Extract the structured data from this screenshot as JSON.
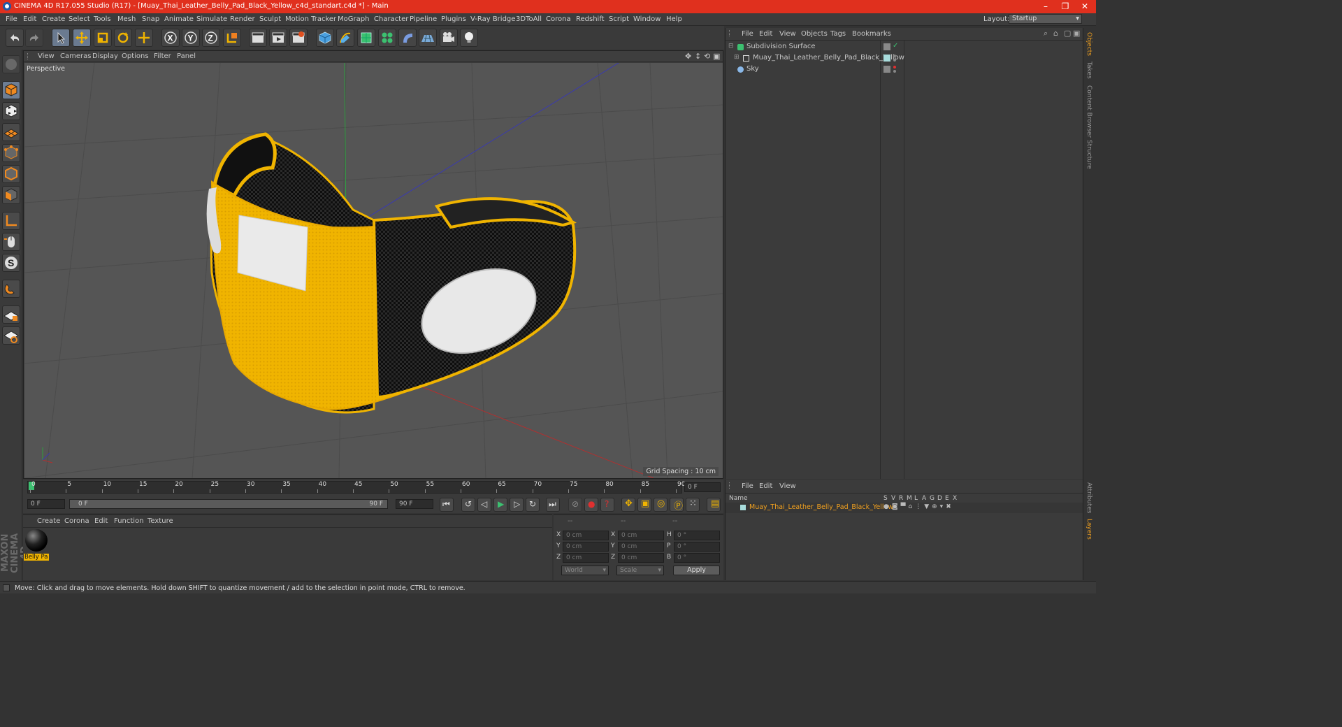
{
  "window": {
    "title": "CINEMA 4D R17.055 Studio (R17) - [Muay_Thai_Leather_Belly_Pad_Black_Yellow_c4d_standart.c4d *] - Main"
  },
  "menu": [
    "File",
    "Edit",
    "Create",
    "Select",
    "Tools",
    "Mesh",
    "Snap",
    "Animate",
    "Simulate",
    "Render",
    "Sculpt",
    "Motion Tracker",
    "MoGraph",
    "Character",
    "Pipeline",
    "Plugins",
    "V-Ray Bridge",
    "3DToAll",
    "Corona",
    "Redshift",
    "Script",
    "Window",
    "Help"
  ],
  "layout": {
    "label": "Layout:",
    "value": "Startup"
  },
  "viewport": {
    "menu": [
      "View",
      "Cameras",
      "Display",
      "Options",
      "Filter",
      "Panel"
    ],
    "label": "Perspective",
    "grid_spacing": "Grid Spacing : 10 cm"
  },
  "timeline": {
    "ticks": [
      "0",
      "5",
      "10",
      "15",
      "20",
      "25",
      "30",
      "35",
      "40",
      "45",
      "50",
      "55",
      "60",
      "65",
      "70",
      "75",
      "80",
      "85",
      "90"
    ],
    "current_frame": "0 F",
    "start": "0 F",
    "range_start": "0 F",
    "range_end": "90 F",
    "end": "90 F"
  },
  "materials": {
    "menu": [
      "Create",
      "Corona",
      "Edit",
      "Function",
      "Texture"
    ],
    "items": [
      {
        "name": "Belly Pa"
      }
    ]
  },
  "coords": {
    "headers": [
      "--",
      "--",
      "--"
    ],
    "rows": [
      {
        "a": "X",
        "v1": "0 cm",
        "b": "X",
        "v2": "0 cm",
        "c": "H",
        "v3": "0 °"
      },
      {
        "a": "Y",
        "v1": "0 cm",
        "b": "Y",
        "v2": "0 cm",
        "c": "P",
        "v3": "0 °"
      },
      {
        "a": "Z",
        "v1": "0 cm",
        "b": "Z",
        "v2": "0 cm",
        "c": "B",
        "v3": "0 °"
      }
    ],
    "mode1": "World",
    "mode2": "Scale",
    "apply": "Apply"
  },
  "objects": {
    "menu": [
      "File",
      "Edit",
      "View",
      "Objects",
      "Tags",
      "Bookmarks"
    ],
    "items": [
      {
        "name": "Subdivision Surface"
      },
      {
        "name": "Muay_Thai_Leather_Belly_Pad_Black_Yellow"
      },
      {
        "name": "Sky"
      }
    ]
  },
  "layers": {
    "menu": [
      "File",
      "Edit",
      "View"
    ],
    "name_header": "Name",
    "cols": [
      "S",
      "V",
      "R",
      "M",
      "L",
      "A",
      "G",
      "D",
      "E",
      "X"
    ],
    "items": [
      {
        "name": "Muay_Thai_Leather_Belly_Pad_Black_Yellow"
      }
    ]
  },
  "sidetabs": [
    "Objects",
    "Takes",
    "Content Browser",
    "Structure",
    "Attributes",
    "Layers"
  ],
  "brand": "MAXON CINEMA 4D",
  "status": "Move: Click and drag to move elements. Hold down SHIFT to quantize movement / add to the selection in point mode, CTRL to remove.",
  "colors": {
    "accent": "#e0301e",
    "yellow": "#f0b400",
    "layer_text": "#f0a020"
  }
}
